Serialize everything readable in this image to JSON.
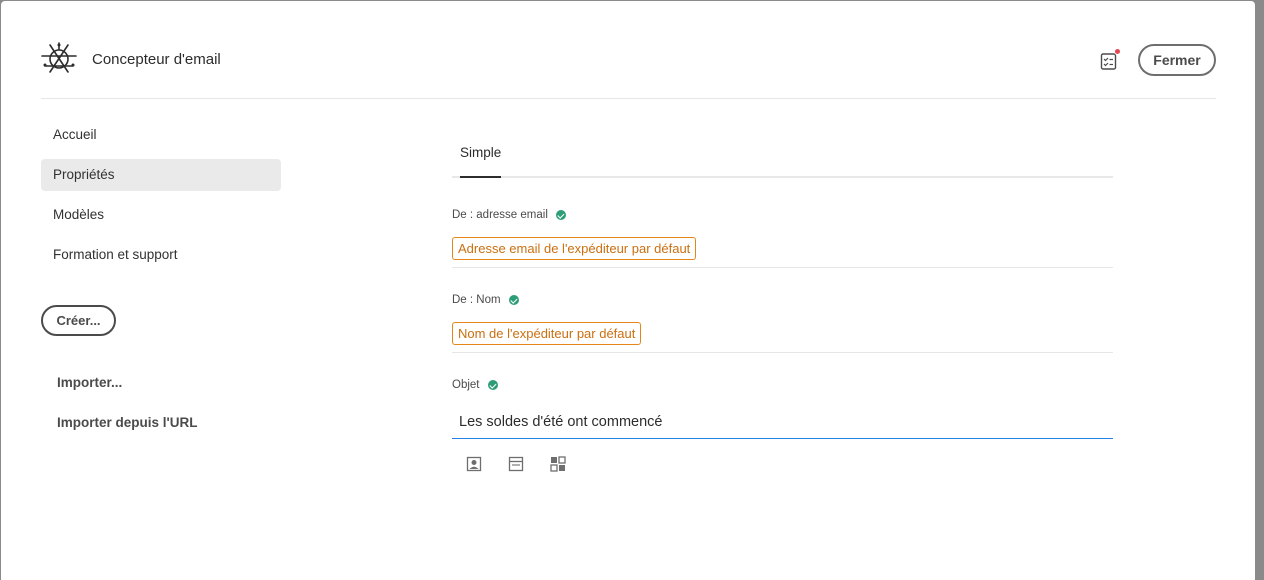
{
  "header": {
    "app_title": "Concepteur d'email",
    "close_label": "Fermer"
  },
  "sidebar": {
    "items": [
      {
        "label": "Accueil",
        "active": false
      },
      {
        "label": "Propriétés",
        "active": true
      },
      {
        "label": "Modèles",
        "active": false
      },
      {
        "label": "Formation et support",
        "active": false
      }
    ],
    "create_label": "Créer...",
    "import_label": "Importer...",
    "import_url_label": "Importer depuis l'URL"
  },
  "main": {
    "tab_label": "Simple",
    "fields": {
      "from_address": {
        "label": "De : adresse email",
        "value": "Adresse email de l'expéditeur par défaut"
      },
      "from_name": {
        "label": "De : Nom",
        "value": "Nom de l'expéditeur par défaut"
      },
      "subject": {
        "label": "Objet",
        "value": "Les soldes d'été ont commencé"
      }
    },
    "toolbar_icons": [
      "personalization-icon",
      "content-block-icon",
      "dynamic-content-icon"
    ]
  },
  "colors": {
    "accent_orange": "#e68619",
    "valid_green": "#2d9d78",
    "focus_blue": "#2680eb",
    "notification_red": "#e34850"
  }
}
